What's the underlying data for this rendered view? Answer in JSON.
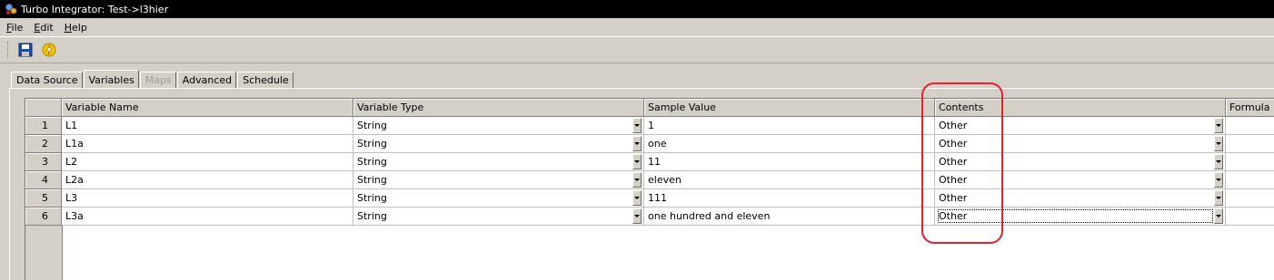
{
  "window": {
    "title": "Turbo Integrator:  Test->l3hier"
  },
  "menu": {
    "items": [
      {
        "label": "File",
        "u": "F",
        "rest": "ile"
      },
      {
        "label": "Edit",
        "u": "E",
        "rest": "dit"
      },
      {
        "label": "Help",
        "u": "H",
        "rest": "elp"
      }
    ]
  },
  "toolbar": {
    "save_icon": "floppy-save-icon",
    "run_icon": "lightning-run-icon"
  },
  "tabs": [
    {
      "label": "Data Source",
      "state": "normal"
    },
    {
      "label": "Variables",
      "state": "active"
    },
    {
      "label": "Maps",
      "state": "disabled"
    },
    {
      "label": "Advanced",
      "state": "normal"
    },
    {
      "label": "Schedule",
      "state": "normal"
    }
  ],
  "grid": {
    "columns": [
      "Variable Name",
      "Variable Type",
      "Sample Value",
      "Contents",
      "Formula"
    ],
    "rows": [
      {
        "num": "1",
        "name": "L1",
        "type": "String",
        "sample": "1",
        "contents": "Other"
      },
      {
        "num": "2",
        "name": "L1a",
        "type": "String",
        "sample": "one",
        "contents": "Other"
      },
      {
        "num": "3",
        "name": "L2",
        "type": "String",
        "sample": "11",
        "contents": "Other"
      },
      {
        "num": "4",
        "name": "L2a",
        "type": "String",
        "sample": "eleven",
        "contents": "Other"
      },
      {
        "num": "5",
        "name": "L3",
        "type": "String",
        "sample": "111",
        "contents": "Other"
      },
      {
        "num": "6",
        "name": "L3a",
        "type": "String",
        "sample": "one hundred and eleven",
        "contents": "Other"
      }
    ],
    "selected_row": "6"
  },
  "colors": {
    "titlebar": "#000000",
    "chrome": "#d4d0c8",
    "annotation_ring": "#e51f2b"
  }
}
